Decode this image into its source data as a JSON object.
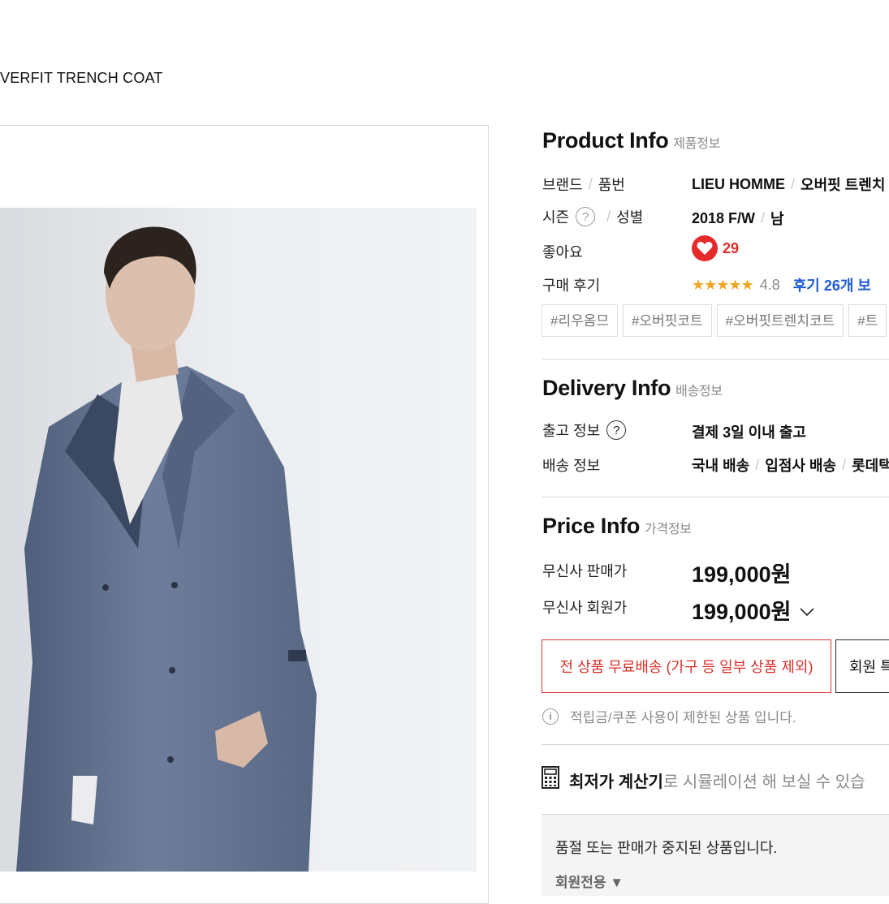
{
  "header": {
    "product_title": "VERFIT TRENCH COAT"
  },
  "product_info": {
    "title": "Product Info",
    "subtitle": "제품정보",
    "brand_label": "브랜드",
    "item_no_label": "품번",
    "brand": "LIEU HOMME",
    "item_name": "오버핏 트렌치",
    "season_label": "시즌",
    "gender_label": "성별",
    "season": "2018 F/W",
    "gender": "남",
    "likes_label": "좋아요",
    "likes_count": "29",
    "review_label": "구매 후기",
    "stars": "★★★★★",
    "rating": "4.8",
    "review_link": "후기 26개 보",
    "tags": [
      "#리우옴므",
      "#오버핏코트",
      "#오버핏트렌치코트",
      "#트"
    ]
  },
  "delivery_info": {
    "title": "Delivery Info",
    "subtitle": "배송정보",
    "ship_label": "출고 정보",
    "ship_value": "결제 3일 이내 출고",
    "delivery_label": "배송 정보",
    "delivery_values": [
      "국내 배송",
      "입점사 배송",
      "롯데택"
    ]
  },
  "price_info": {
    "title": "Price Info",
    "subtitle": "가격정보",
    "sale_label": "무신사 판매가",
    "sale_price": "199,000원",
    "member_label": "무신사 회원가",
    "member_price": "199,000원"
  },
  "buttons": {
    "free_shipping": "전 상품 무료배송 (가구 등 일부 상품 제외)",
    "member_benefit": "회원 특"
  },
  "notice": {
    "text": "적립금/쿠폰 사용이 제한된 상품 입니다."
  },
  "calculator": {
    "strong": "최저가 계산기",
    "rest": "로 시뮬레이션 해 보실 수 있습"
  },
  "soldout": {
    "text": "품절 또는 판매가 중지된 상품입니다.",
    "member_only": "회원전용 ▼"
  },
  "colors": {
    "accent_red": "#e52a2a",
    "link_blue": "#1f5bd3",
    "star_orange": "#f2a522"
  }
}
